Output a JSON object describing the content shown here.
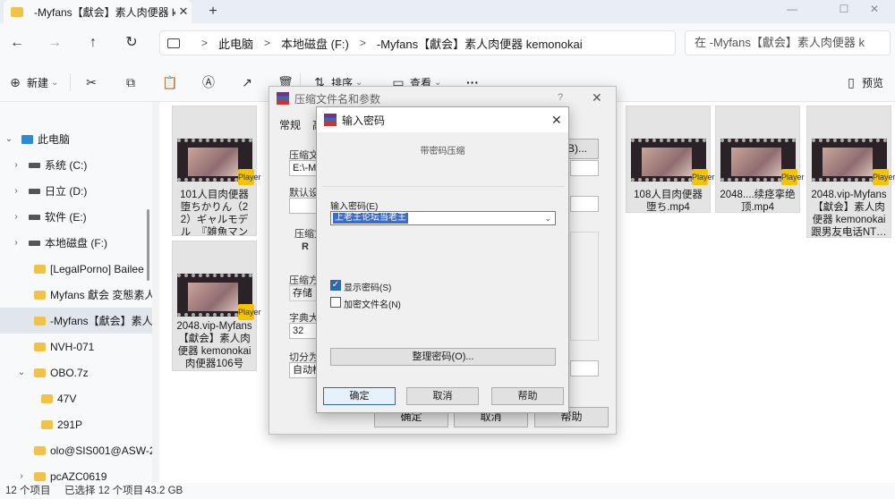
{
  "tab": {
    "title": "-Myfans【獻会】素人肉便器 ke",
    "close": "✕",
    "new_tab": "+"
  },
  "window_controls": {
    "minimize": "—",
    "maximize": "☐",
    "close": "✕"
  },
  "nav": {
    "back": "←",
    "forward": "→",
    "up": "↑",
    "refresh": "↻"
  },
  "address": {
    "crumbs": [
      "此电脑",
      "本地磁盘 (F:)",
      "-Myfans【獻会】素人肉便器 kemonokai"
    ],
    "separator": ">"
  },
  "search": {
    "placeholder": "在 -Myfans【獻会】素人肉便器 k"
  },
  "toolbar": {
    "new_label": "新建",
    "new_icon": "⊕",
    "cut_icon": "✂",
    "copy_icon": "⧉",
    "paste_icon": "📋",
    "rename_icon": "Ⓐ",
    "share_icon": "↗",
    "delete_icon": "🗑",
    "sort_label": "排序",
    "sort_icon": "⇅",
    "view_label": "查看",
    "view_icon": "▭",
    "more": "···",
    "preview_label": "预览",
    "preview_icon": "▯",
    "caret": "⌄"
  },
  "sidebar": {
    "items": [
      {
        "label": "此电脑",
        "chev": "⌄",
        "kind": "pc"
      },
      {
        "label": "系统 (C:)",
        "chev": "›",
        "kind": "drive"
      },
      {
        "label": "日立 (D:)",
        "chev": "›",
        "kind": "drive"
      },
      {
        "label": "软件 (E:)",
        "chev": "›",
        "kind": "drive"
      },
      {
        "label": "本地磁盘 (F:)",
        "chev": "›",
        "kind": "drive"
      },
      {
        "label": "[LegalPorno] Bailee I",
        "chev": "",
        "kind": "folder"
      },
      {
        "label": "Myfans 獻会 変態素人",
        "chev": "",
        "kind": "folder"
      },
      {
        "label": "-Myfans【獻会】素人",
        "chev": "",
        "kind": "folder"
      },
      {
        "label": "NVH-071",
        "chev": "",
        "kind": "folder"
      },
      {
        "label": "OBO.7z",
        "chev": "⌄",
        "kind": "folder"
      },
      {
        "label": "47V",
        "chev": "",
        "kind": "folder"
      },
      {
        "label": "291P",
        "chev": "",
        "kind": "folder"
      },
      {
        "label": "olo@SIS001@ASW-2",
        "chev": "",
        "kind": "folder"
      },
      {
        "label": "pcAZC0619",
        "chev": "›",
        "kind": "folder"
      }
    ]
  },
  "files": [
    {
      "caption": "101人目肉便器堕ちかりん（22）ギャルモデル_『雑魚マンオホ声…",
      "badge": "Player"
    },
    {
      "caption": "2048.vip-Myfans【獻会】素人肉便器 kemonokai 肉便器106号 1…",
      "badge": "Player"
    },
    {
      "caption": "108人目肉便器堕ち.mp4",
      "badge": "Player"
    },
    {
      "caption": "2048....续痉挛绝顶.mp4",
      "badge": "Player"
    },
    {
      "caption": "2048.vip-Myfans【獻会】素人肉便器 kemonokai 跟男友电话NT…",
      "badge": "Player"
    }
  ],
  "status": {
    "count": "12 个项目",
    "selected": "已选择 12 个项目",
    "size": "43.2 GB"
  },
  "archive_dialog": {
    "title": "压缩文件名和参数",
    "help": "?",
    "close": "✕",
    "tab_general": "常规",
    "tab_second": "高",
    "label_archive": "压缩文",
    "field_archive": "E:\\-My",
    "browse": "(B)...",
    "label_default": "默认设",
    "label_format": "压缩文",
    "radio": "R",
    "label_method": "压缩方",
    "field_method": "存储",
    "label_dict": "字典大",
    "field_dict": "32",
    "label_split": "切分为",
    "field_split": "自动检",
    "ok": "确定",
    "cancel": "取消",
    "helpbtn": "帮助"
  },
  "password_dialog": {
    "title": "输入密码",
    "close": "✕",
    "subtitle": "带密码压缩",
    "label": "输入密码(E)",
    "value": "上老王论坛当老王",
    "show_password": "显示密码(S)",
    "show_password_checked": true,
    "encrypt_names": "加密文件名(N)",
    "encrypt_names_checked": false,
    "organize": "整理密码(O)...",
    "ok": "确定",
    "cancel": "取消",
    "help": "帮助"
  }
}
